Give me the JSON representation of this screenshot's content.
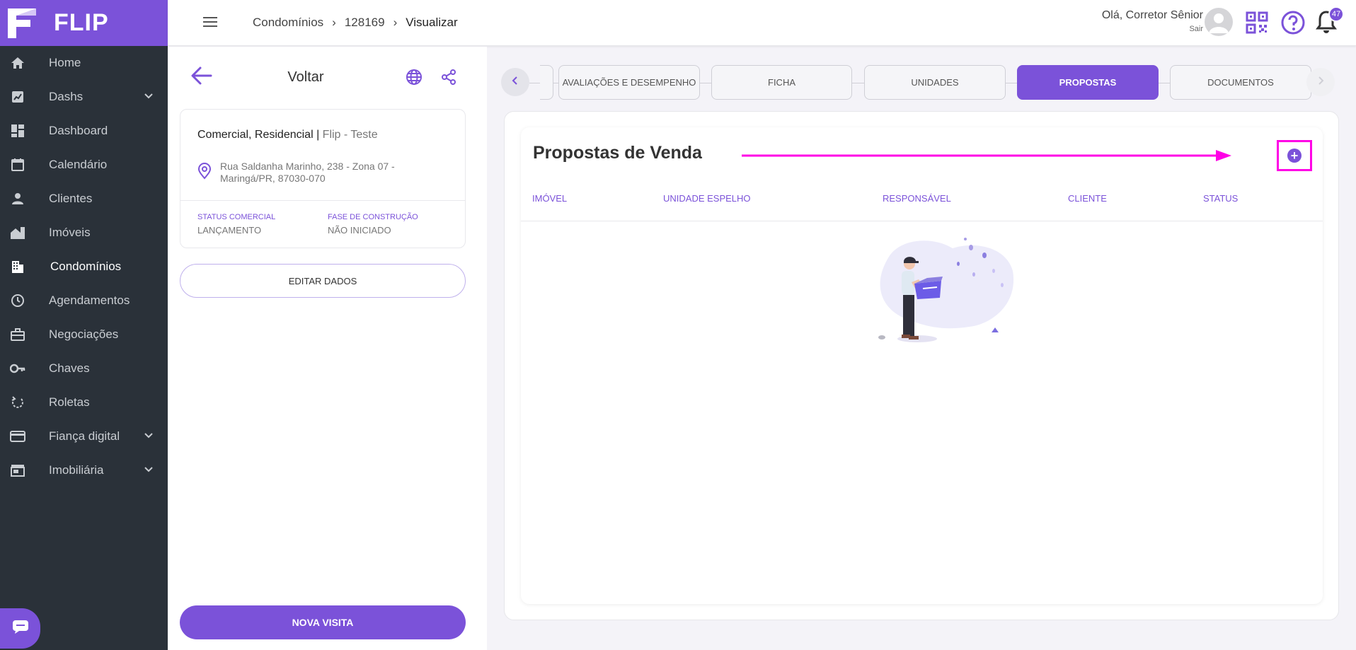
{
  "brand": {
    "name": "FLIP"
  },
  "sidebar": {
    "items": [
      {
        "label": "Home",
        "icon": "home-icon",
        "has_submenu": false,
        "active": false
      },
      {
        "label": "Dashs",
        "icon": "chart-icon",
        "has_submenu": true,
        "active": false
      },
      {
        "label": "Dashboard",
        "icon": "dashboard-icon",
        "has_submenu": false,
        "active": false
      },
      {
        "label": "Calendário",
        "icon": "calendar-icon",
        "has_submenu": false,
        "active": false
      },
      {
        "label": "Clientes",
        "icon": "person-icon",
        "has_submenu": false,
        "active": false
      },
      {
        "label": "Imóveis",
        "icon": "buildings-icon",
        "has_submenu": false,
        "active": false
      },
      {
        "label": "Condomínios",
        "icon": "building-icon",
        "has_submenu": false,
        "active": true
      },
      {
        "label": "Agendamentos",
        "icon": "clock-icon",
        "has_submenu": false,
        "active": false
      },
      {
        "label": "Negociações",
        "icon": "briefcase-icon",
        "has_submenu": false,
        "active": false
      },
      {
        "label": "Chaves",
        "icon": "key-icon",
        "has_submenu": false,
        "active": false
      },
      {
        "label": "Roletas",
        "icon": "rotate-icon",
        "has_submenu": false,
        "active": false
      },
      {
        "label": "Fiança digital",
        "icon": "card-icon",
        "has_submenu": true,
        "active": false
      },
      {
        "label": "Imobiliária",
        "icon": "store-icon",
        "has_submenu": true,
        "active": false
      }
    ]
  },
  "topbar": {
    "breadcrumbs": [
      "Condomínios",
      "128169",
      "Visualizar"
    ],
    "greeting": "Olá, Corretor Sênior",
    "logout": "Sair",
    "notifications": "47"
  },
  "detail": {
    "back_label": "Voltar",
    "type_label": "Comercial, Residencial |",
    "name": "Flip - Teste",
    "address_line1": "Rua Saldanha Marinho, 238 - Zona 07 -",
    "address_line2": "Maringá/PR, 87030-070",
    "status_label": "STATUS COMERCIAL",
    "status_value": "LANÇAMENTO",
    "phase_label": "FASE DE CONSTRUÇÃO",
    "phase_value": "NÃO INICIADO",
    "edit_button": "EDITAR DADOS",
    "new_visit_button": "NOVA VISITA"
  },
  "tabs": {
    "items": [
      {
        "label": "AVALIAÇÕES E DESEMPENHO",
        "active": false
      },
      {
        "label": "FICHA",
        "active": false
      },
      {
        "label": "UNIDADES",
        "active": false
      },
      {
        "label": "PROPOSTAS",
        "active": true
      },
      {
        "label": "DOCUMENTOS",
        "active": false
      }
    ]
  },
  "proposals": {
    "title": "Propostas de Venda",
    "add_symbol": "+",
    "columns": [
      "IMÓVEL",
      "UNIDADE ESPELHO",
      "RESPONSÁVEL",
      "CLIENTE",
      "STATUS"
    ]
  },
  "colors": {
    "accent": "#7b52d9",
    "sidebar_bg": "#2a3139",
    "annotation": "#ff00e6"
  }
}
